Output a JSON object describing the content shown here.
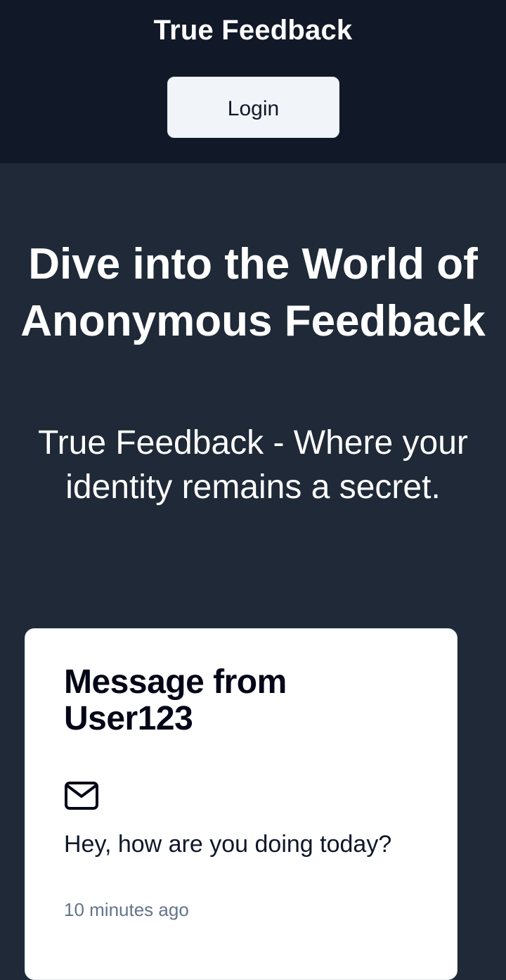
{
  "navbar": {
    "brand": "True Feedback",
    "login_label": "Login"
  },
  "hero": {
    "title": "Dive into the World of Anonymous Feedback",
    "subtitle": "True Feedback - Where your identity remains a secret."
  },
  "message_card": {
    "title": "Message from User123",
    "icon": "mail-icon",
    "content": "Hey, how are you doing today?",
    "time": "10 minutes ago"
  },
  "colors": {
    "navbar_bg": "#111827",
    "page_bg": "#1f2937",
    "button_bg": "#f1f5f9",
    "card_bg": "#ffffff",
    "muted_text": "#64748b"
  }
}
